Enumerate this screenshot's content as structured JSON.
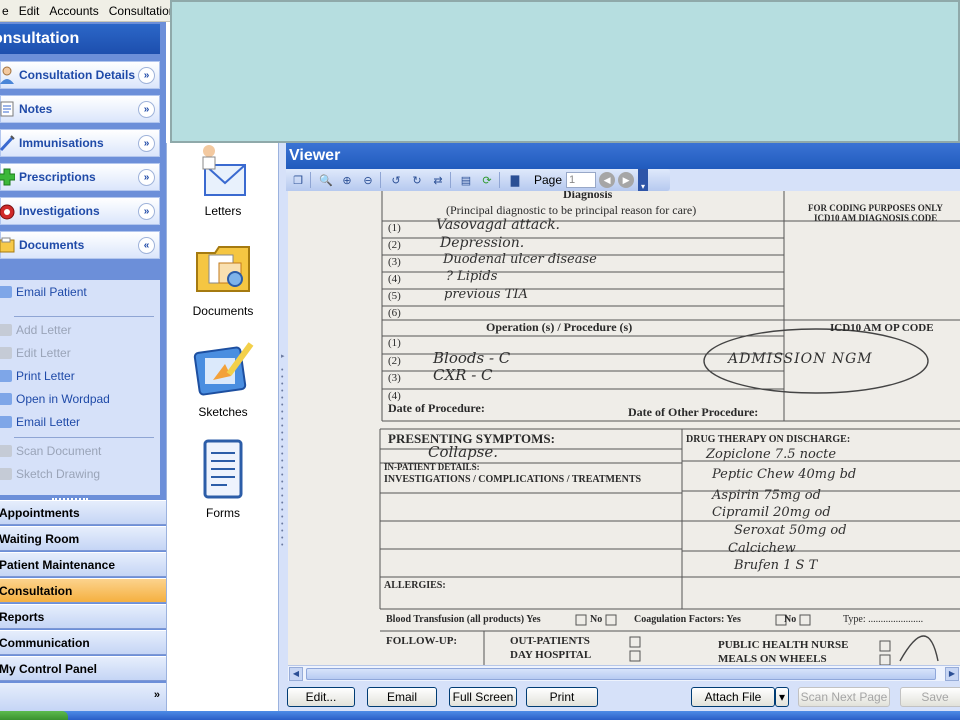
{
  "menu": [
    "e",
    "Edit",
    "Accounts",
    "Consultation"
  ],
  "sidebar": {
    "title": "onsultation",
    "sections": [
      {
        "label": "Consultation Details",
        "icon": "doctor-icon",
        "state": "collapsed"
      },
      {
        "label": "Notes",
        "icon": "notes-icon",
        "state": "collapsed"
      },
      {
        "label": "Immunisations",
        "icon": "syringe-icon",
        "state": "collapsed"
      },
      {
        "label": "Prescriptions",
        "icon": "prescription-cross-icon",
        "state": "collapsed"
      },
      {
        "label": "Investigations",
        "icon": "investigations-icon",
        "state": "collapsed"
      },
      {
        "label": "Documents",
        "icon": "documents-icon",
        "state": "expanded"
      }
    ],
    "tasks": [
      {
        "label": "Email Patient",
        "enabled": true
      },
      {
        "label": "Add Letter",
        "enabled": false
      },
      {
        "label": "Edit Letter",
        "enabled": false
      },
      {
        "label": "Print Letter",
        "enabled": true
      },
      {
        "label": "Open in Wordpad",
        "enabled": true
      },
      {
        "label": "Email Letter",
        "enabled": true
      },
      {
        "label": "Scan Document",
        "enabled": false
      },
      {
        "label": "Sketch Drawing",
        "enabled": false
      }
    ],
    "nav": [
      "Appointments",
      "Waiting Room",
      "Patient Maintenance",
      "Consultation",
      "Reports",
      "Communication",
      "My Control Panel"
    ],
    "active_nav": "Consultation"
  },
  "midpane": {
    "items": [
      {
        "label": "Letters",
        "icon": "letters-icon"
      },
      {
        "label": "Documents",
        "icon": "documents-folder-icon"
      },
      {
        "label": "Sketches",
        "icon": "sketches-icon"
      },
      {
        "label": "Forms",
        "icon": "forms-icon"
      }
    ]
  },
  "viewer": {
    "title": "Viewer",
    "page_label": "Page",
    "page_value": "1",
    "toolbar_icons": [
      "fit-icon",
      "zoom-icon",
      "zoom-in-icon",
      "zoom-out-icon",
      "rotate-left-icon",
      "rotate-right-icon",
      "flip-icon",
      "scan-icon",
      "refresh-icon",
      "chart-icon"
    ],
    "buttons": {
      "edit": "Edit...",
      "email": "Email",
      "full_screen": "Full Screen",
      "print": "Print",
      "attach_file": "Attach File",
      "scan_next_page": "Scan Next Page",
      "save": "Save"
    }
  },
  "scan": {
    "diagnosis_heading": "Diagnosis",
    "diagnosis_sub": "(Principal diagnostic to be principal reason for care)",
    "coding_note_1": "FOR CODING PURPOSES ONLY",
    "coding_note_2": "ICD10 AM DIAGNOSIS CODE",
    "diag_nums": [
      "(1)",
      "(2)",
      "(3)",
      "(4)",
      "(5)",
      "(6)"
    ],
    "diag_hw": [
      "Vasovagal attack.",
      "Depression.",
      "Duodenal ulcer disease",
      "? Lipids",
      "previous TIA"
    ],
    "operation_heading": "Operation (s) / Procedure (s)",
    "op_code": "ICD10 AM OP CODE",
    "op_nums": [
      "(1)",
      "(2)",
      "(3)",
      "(4)"
    ],
    "op_hw": [
      "Bloods - C",
      "CXR - C"
    ],
    "admission_stamp": "ADMISSION NGM",
    "date_of_procedure": "Date of Procedure:",
    "date_of_other_procedure": "Date of Other Procedure:",
    "presenting_symptoms": "PRESENTING SYMPTOMS:",
    "presenting_hw": "Collapse.",
    "drug_therapy": "DRUG THERAPY ON DISCHARGE:",
    "inpatient_details": "IN-PATIENT DETAILS:",
    "investigations": "INVESTIGATIONS / COMPLICATIONS / TREATMENTS",
    "drug_hw": [
      "Zopiclone 7.5 nocte",
      "Peptic Chew 40mg bd",
      "Aspirin 75mg od",
      "Cipramil 20mg od",
      "Seroxat 50mg od",
      "Calcichew",
      "Brufen 1 S T"
    ],
    "allergies": "ALLERGIES:",
    "blood_transfusion": "Blood Transfusion (all products) Yes",
    "no_1": "No",
    "coagulation": "Coagulation Factors: Yes",
    "no_2": "No",
    "type": "Type: ......................",
    "follow_up": "FOLLOW-UP:",
    "outpatients": "OUT-PATIENTS",
    "day_hospital": "DAY HOSPITAL",
    "public_health_nurse": "PUBLIC HEALTH NURSE",
    "meals_on_wheels": "MEALS ON WHEELS"
  },
  "colors": {
    "sidebar_bg": "#6c8fd9",
    "header_blue": "#2c67c8",
    "active_nav": "#f5b040",
    "overlay": "#b6dee0",
    "section_text": "#1f4aa8"
  }
}
